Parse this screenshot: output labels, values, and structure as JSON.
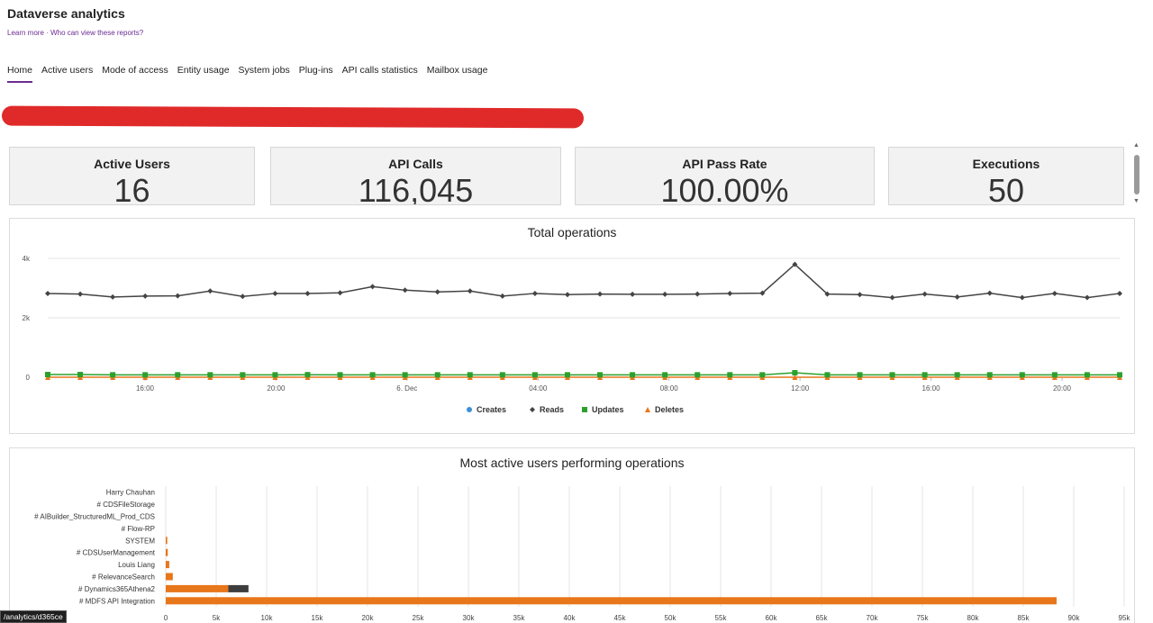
{
  "header": {
    "title": "Dataverse analytics",
    "learn_more": "Learn more",
    "separator": "·",
    "who_can_view": "Who can view these reports?"
  },
  "tabs": [
    {
      "label": "Home",
      "active": true
    },
    {
      "label": "Active users"
    },
    {
      "label": "Mode of access"
    },
    {
      "label": "Entity usage"
    },
    {
      "label": "System jobs"
    },
    {
      "label": "Plug-ins"
    },
    {
      "label": "API calls statistics"
    },
    {
      "label": "Mailbox usage"
    }
  ],
  "kpis": [
    {
      "label": "Active Users",
      "value": "16"
    },
    {
      "label": "API Calls",
      "value": "116,045"
    },
    {
      "label": "API Pass Rate",
      "value": "100.00%"
    },
    {
      "label": "Executions",
      "value": "50"
    }
  ],
  "status_url": "/analytics/d365ce",
  "chart_data": [
    {
      "type": "line",
      "title": "Total operations",
      "x_tick_labels": [
        "16:00",
        "20:00",
        "6. Dec",
        "04:00",
        "08:00",
        "12:00",
        "16:00",
        "20:00"
      ],
      "y_tick_labels": [
        "0",
        "2k",
        "4k"
      ],
      "ylim": [
        0,
        4000
      ],
      "legend_position": "bottom-center",
      "series": [
        {
          "name": "Creates",
          "color": "#3b8fd9",
          "marker": "circle",
          "values": [
            20,
            20,
            20,
            20,
            20,
            20,
            20,
            20,
            20,
            20,
            20,
            20,
            20,
            20,
            20,
            20,
            20,
            20,
            20,
            20,
            20,
            20,
            20,
            20,
            20,
            20,
            20,
            20,
            20,
            20,
            20,
            20,
            20,
            20,
            20,
            20
          ]
        },
        {
          "name": "Reads",
          "color": "#444444",
          "marker": "diamond",
          "values": [
            2820,
            2800,
            2700,
            2730,
            2740,
            2900,
            2720,
            2820,
            2820,
            2840,
            3050,
            2930,
            2870,
            2900,
            2730,
            2820,
            2780,
            2800,
            2790,
            2790,
            2800,
            2820,
            2830,
            3800,
            2800,
            2780,
            2680,
            2800,
            2700,
            2830,
            2680,
            2820,
            2680,
            2820
          ]
        },
        {
          "name": "Updates",
          "color": "#2ca02c",
          "marker": "square",
          "values": [
            90,
            90,
            80,
            80,
            80,
            80,
            80,
            80,
            85,
            80,
            80,
            80,
            80,
            80,
            80,
            80,
            80,
            80,
            80,
            80,
            80,
            80,
            80,
            150,
            80,
            80,
            80,
            80,
            80,
            80,
            80,
            80,
            80,
            80
          ]
        },
        {
          "name": "Deletes",
          "color": "#e8761a",
          "marker": "triangle",
          "values": [
            0,
            0,
            0,
            0,
            0,
            0,
            0,
            0,
            0,
            0,
            0,
            0,
            0,
            0,
            0,
            0,
            0,
            0,
            0,
            0,
            0,
            0,
            0,
            0,
            0,
            0,
            0,
            0,
            0,
            0,
            0,
            0,
            0,
            0
          ]
        }
      ]
    },
    {
      "type": "bar",
      "orientation": "horizontal",
      "stacked": true,
      "title": "Most active users performing operations",
      "categories": [
        "Harry Chauhan",
        "# CDSFileStorage",
        "# AIBuilder_StructuredML_Prod_CDS",
        "# Flow-RP",
        "SYSTEM",
        "# CDSUserManagement",
        "Louis Liang",
        "# RelevanceSearch",
        "# Dynamics365Athena2",
        "# MDFS API Integration"
      ],
      "x_tick_labels": [
        "0",
        "5k",
        "10k",
        "15k",
        "20k",
        "25k",
        "30k",
        "35k",
        "40k",
        "45k",
        "50k",
        "55k",
        "60k",
        "65k",
        "70k",
        "75k",
        "80k",
        "85k",
        "90k",
        "95k"
      ],
      "xlim": [
        0,
        95000
      ],
      "series": [
        {
          "name": "",
          "color": "#e8761a",
          "values": [
            0,
            0,
            0,
            0,
            150,
            200,
            350,
            700,
            6200,
            88300
          ]
        },
        {
          "name": "",
          "color": "#3d3d3d",
          "values": [
            0,
            0,
            0,
            0,
            0,
            0,
            0,
            0,
            2000,
            0
          ]
        }
      ]
    }
  ]
}
